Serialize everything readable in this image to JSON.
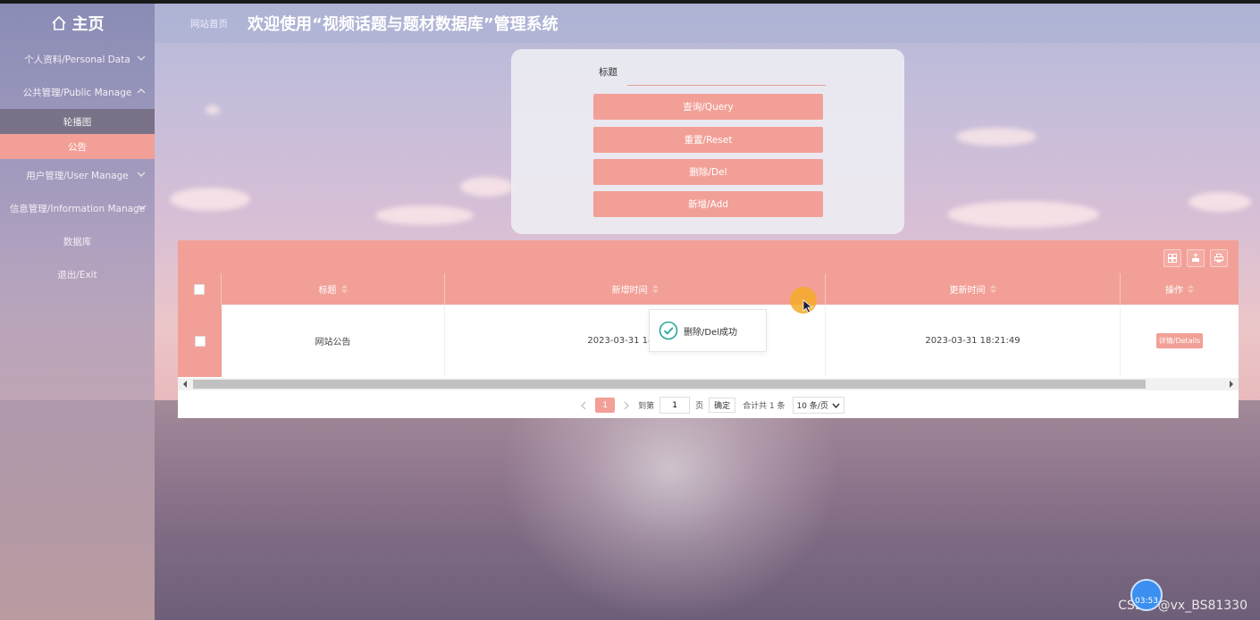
{
  "sidebar": {
    "home_label": "主页",
    "items": [
      {
        "label": "个人资料/Personal Data"
      },
      {
        "label": "公共管理/Public Manage"
      },
      {
        "label": "用户管理/User Manage"
      },
      {
        "label": "信息管理/Information Manage"
      },
      {
        "label": "数据库"
      },
      {
        "label": "退出/Exit"
      }
    ],
    "submenu": [
      {
        "label": "轮播图"
      },
      {
        "label": "公告"
      }
    ]
  },
  "header": {
    "breadcrumb": "网站首页",
    "title": "欢迎使用“视频话题与题材数据库”管理系统"
  },
  "search": {
    "field_label": "标题",
    "value": "",
    "buttons": {
      "query": "查询/Query",
      "reset": "重置/Reset",
      "delete": "删除/Del",
      "add": "新增/Add"
    }
  },
  "table": {
    "columns": [
      "标题",
      "新增时间",
      "更新时间",
      "操作"
    ],
    "rows": [
      {
        "title": "网站公告",
        "created": "2023-03-31 18:21:49",
        "updated": "2023-03-31 18:21:49",
        "action": "详情/Details"
      }
    ]
  },
  "pagination": {
    "current_page": "1",
    "goto_label": "到第",
    "goto_value": "1",
    "page_unit": "页",
    "confirm": "确定",
    "total": "合计共 1 条",
    "page_size": "10 条/页"
  },
  "toast": {
    "message": "删除/Del成功"
  },
  "overlay": {
    "watermark": "CSDN @vx_BS81330",
    "timer": "03:53"
  },
  "colors": {
    "accent": "#f2a097",
    "sidebar_active": "#f2a097",
    "toast_check": "#26a69a",
    "timer": "#3b8ff0"
  }
}
